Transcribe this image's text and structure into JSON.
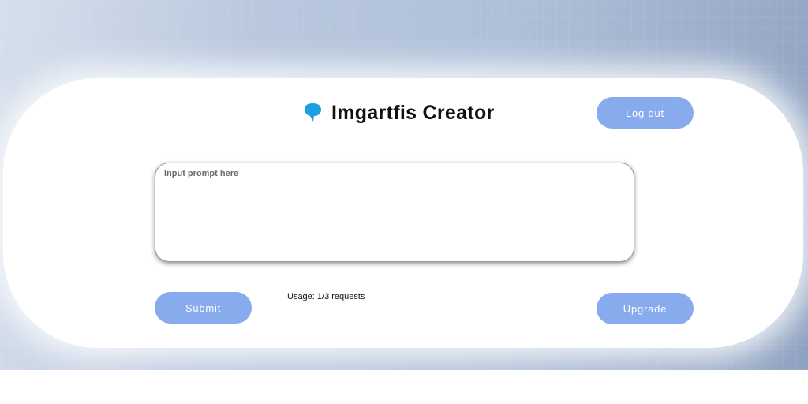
{
  "app": {
    "title": "Imgartfis Creator",
    "logo_icon": "chat-bubble-icon"
  },
  "header": {
    "logout_label": "Log out"
  },
  "prompt": {
    "placeholder": "Input prompt here",
    "value": ""
  },
  "actions": {
    "submit_label": "Submit",
    "upgrade_label": "Upgrade"
  },
  "usage": {
    "text": "Usage: 1/3 requests"
  },
  "colors": {
    "accent": "#88abee",
    "logo": "#1e9fe0",
    "title_text": "#111111"
  }
}
